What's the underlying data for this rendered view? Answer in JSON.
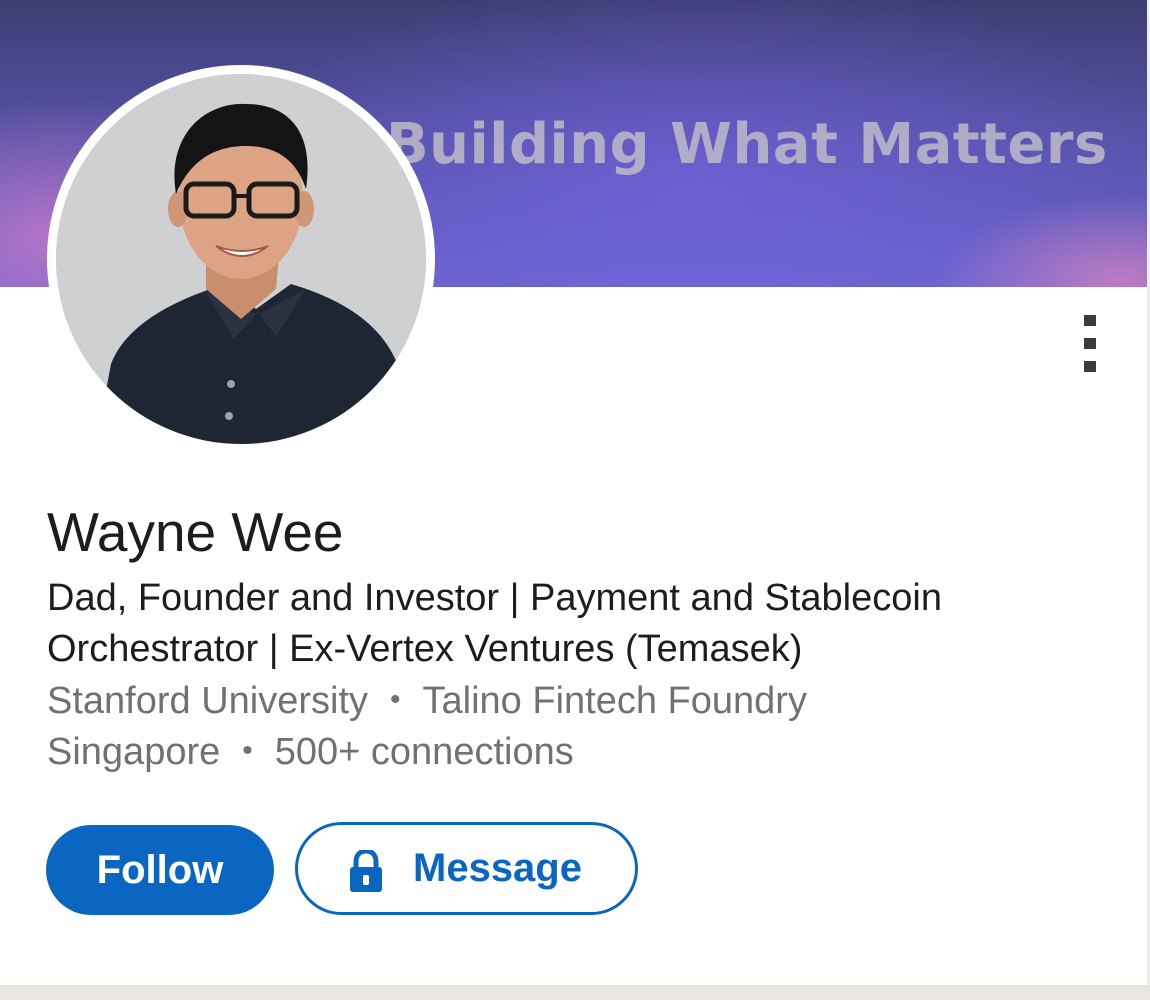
{
  "banner": {
    "title": "Building What Matters"
  },
  "profile": {
    "name": "Wayne Wee",
    "headline_line1": "Dad, Founder and Investor | Payment and Stablecoin",
    "headline_line2": "Orchestrator | Ex-Vertex Ventures (Temasek)",
    "education": "Stanford University",
    "company": "Talino Fintech Foundry",
    "location": "Singapore",
    "connections": "500+ connections",
    "separator": "•"
  },
  "actions": {
    "follow_label": "Follow",
    "message_label": "Message"
  },
  "icons": {
    "more": "more-vertical-icon",
    "lock": "lock-icon"
  },
  "colors": {
    "accent": "#0b66c2",
    "text_primary": "#1d1d1d",
    "text_secondary": "#717171"
  }
}
